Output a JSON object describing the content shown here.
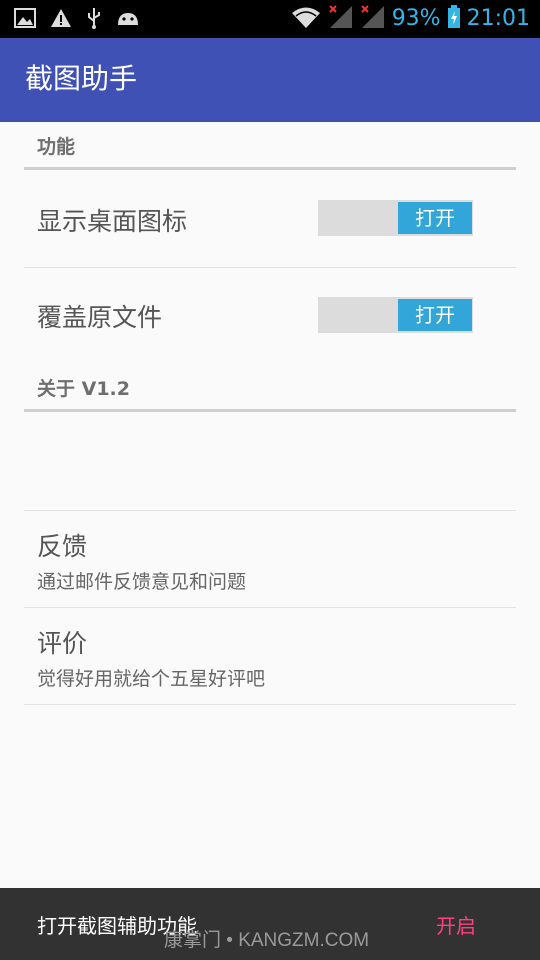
{
  "status_bar": {
    "battery_percent": "93%",
    "time": "21:01",
    "icons": [
      "image-icon",
      "warning-icon",
      "usb-icon",
      "android-icon",
      "wifi-icon",
      "signal-icon",
      "signal-icon-2",
      "battery-icon"
    ]
  },
  "app_bar": {
    "title": "截图助手"
  },
  "sections": {
    "features": {
      "header": "功能",
      "items": [
        {
          "title": "显示桌面图标",
          "toggle_label": "打开"
        },
        {
          "title": "覆盖原文件",
          "toggle_label": "打开"
        }
      ]
    },
    "about": {
      "header": "关于 V1.2",
      "items": [
        {
          "title": "反馈",
          "summary": "通过邮件反馈意见和问题"
        },
        {
          "title": "评价",
          "summary": "觉得好用就给个五星好评吧"
        }
      ]
    }
  },
  "snackbar": {
    "message": "打开截图辅助功能",
    "action": "开启"
  },
  "watermark": "康掌门 • KANGZM.COM",
  "colors": {
    "primary": "#3f51b5",
    "toggle_on": "#33a6d9",
    "snackbar_action": "#ff4081",
    "status_accent": "#33b5e5"
  }
}
